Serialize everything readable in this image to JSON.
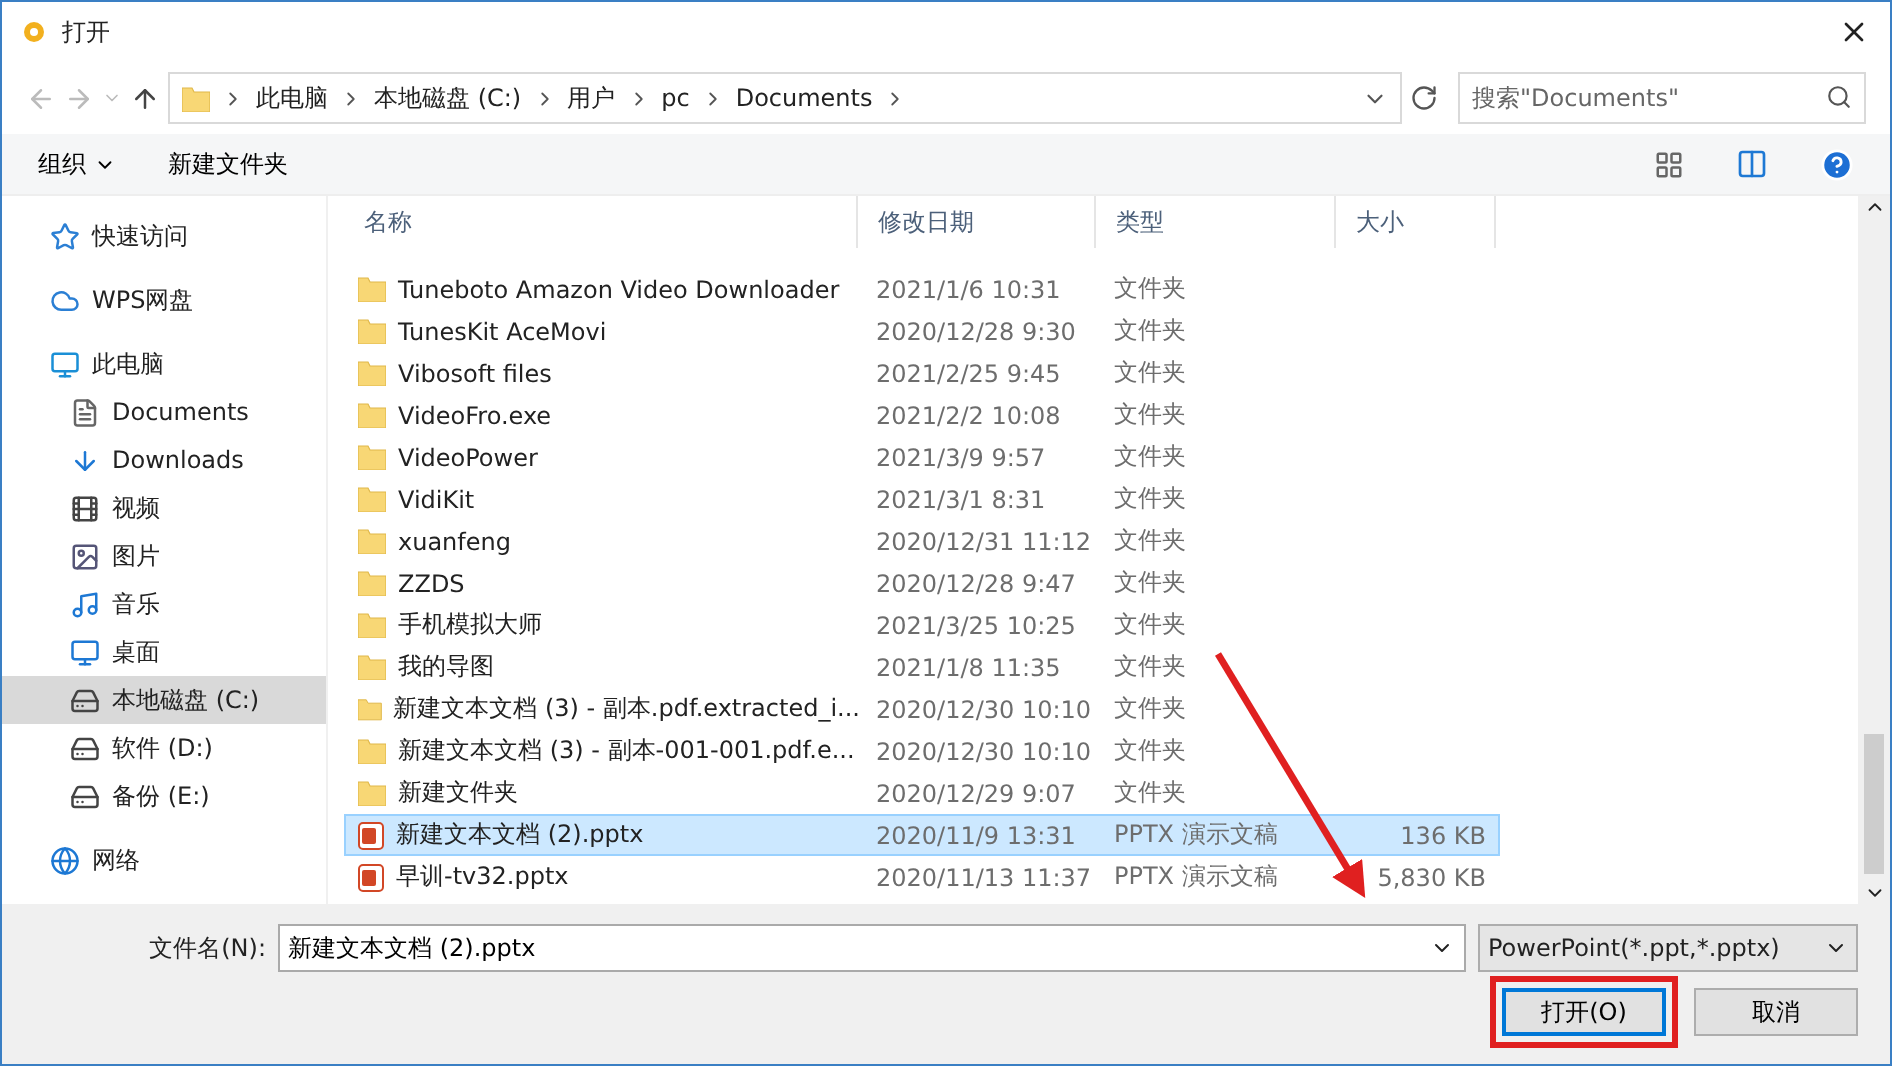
{
  "window": {
    "title": "打开"
  },
  "address": {
    "crumbs": [
      "此电脑",
      "本地磁盘 (C:)",
      "用户",
      "pc",
      "Documents"
    ],
    "search_placeholder": "搜索\"Documents\""
  },
  "toolbar": {
    "items": [
      "组织",
      "新建文件夹"
    ]
  },
  "sidebar": {
    "items": [
      {
        "label": "快速访问",
        "selected": false
      },
      {
        "label": "WPS网盘",
        "selected": false
      },
      {
        "label": "此电脑",
        "selected": false,
        "children": [
          {
            "label": "Documents",
            "selected": false
          },
          {
            "label": "Downloads",
            "selected": false
          },
          {
            "label": "视频",
            "selected": false
          },
          {
            "label": "图片",
            "selected": false
          },
          {
            "label": "音乐",
            "selected": false
          },
          {
            "label": "桌面",
            "selected": false
          },
          {
            "label": "本地磁盘 (C:)",
            "selected": true
          },
          {
            "label": "软件 (D:)",
            "selected": false
          },
          {
            "label": "备份 (E:)",
            "selected": false
          }
        ]
      },
      {
        "label": "网络",
        "selected": false
      }
    ]
  },
  "table": {
    "columns": [
      "名称",
      "修改日期",
      "类型",
      "大小"
    ],
    "rows": [
      {
        "kind": "folder",
        "name": "Tuneboto Amazon Video Downloader",
        "date": "2021/1/6 10:31",
        "type": "文件夹",
        "selected": false
      },
      {
        "kind": "folder",
        "name": "TunesKit AceMovi",
        "date": "2020/12/28 9:30",
        "type": "文件夹",
        "selected": false
      },
      {
        "kind": "folder",
        "name": "Vibosoft files",
        "date": "2021/2/25 9:45",
        "type": "文件夹",
        "selected": false
      },
      {
        "kind": "folder",
        "name": "VideoFro.exe",
        "date": "2021/2/2 10:08",
        "type": "文件夹",
        "selected": false
      },
      {
        "kind": "folder",
        "name": "VideoPower",
        "date": "2021/3/9 9:57",
        "type": "文件夹",
        "selected": false
      },
      {
        "kind": "folder",
        "name": "VidiKit",
        "date": "2021/3/1 8:31",
        "type": "文件夹",
        "selected": false
      },
      {
        "kind": "folder",
        "name": "xuanfeng",
        "date": "2020/12/31 11:12",
        "type": "文件夹",
        "selected": false
      },
      {
        "kind": "folder",
        "name": "ZZDS",
        "date": "2020/12/28 9:47",
        "type": "文件夹",
        "selected": false
      },
      {
        "kind": "folder",
        "name": "手机模拟大师",
        "date": "2021/3/25 10:25",
        "type": "文件夹",
        "selected": false
      },
      {
        "kind": "folder",
        "name": "我的导图",
        "date": "2021/1/8 11:35",
        "type": "文件夹",
        "selected": false
      },
      {
        "kind": "folder",
        "name": "新建文本文档 (3) - 副本.pdf.extracted_i...",
        "date": "2020/12/30 10:10",
        "type": "文件夹",
        "selected": false
      },
      {
        "kind": "folder",
        "name": "新建文本文档 (3) - 副本-001-001.pdf.e...",
        "date": "2020/12/30 10:10",
        "type": "文件夹",
        "selected": false
      },
      {
        "kind": "folder",
        "name": "新建文件夹",
        "date": "2020/12/29 9:07",
        "type": "文件夹",
        "selected": false
      },
      {
        "kind": "pptx",
        "name": "新建文本文档 (2).pptx",
        "date": "2020/11/9 13:31",
        "type": "PPTX 演示文稿",
        "size": "136 KB",
        "selected": true
      },
      {
        "kind": "pptx",
        "name": "早训-tv32.pptx",
        "date": "2020/11/13 11:37",
        "type": "PPTX 演示文稿",
        "size": "5,830 KB",
        "selected": false
      }
    ]
  },
  "footer": {
    "filename_label": "文件名(N):",
    "filename": "新建文本文档 (2).pptx",
    "filter": "PowerPoint(*.ppt,*.pptx)",
    "buttons": [
      {
        "label": "打开(O)",
        "highlighted": true
      },
      {
        "label": "取消",
        "highlighted": false
      }
    ]
  }
}
